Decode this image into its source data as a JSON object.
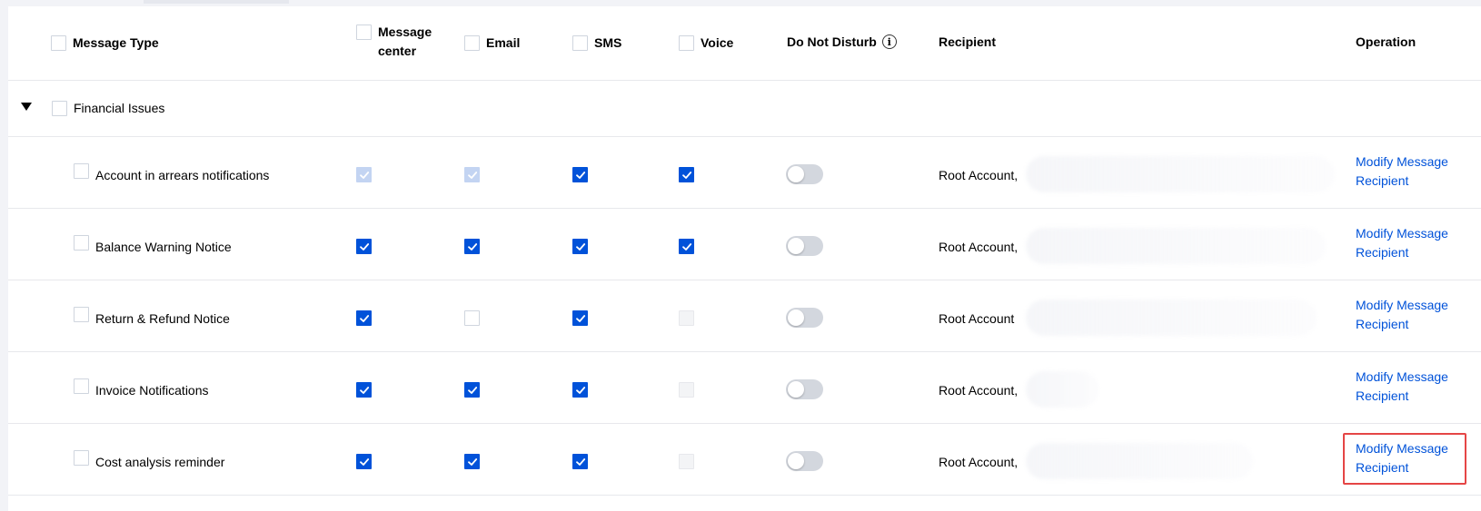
{
  "header": {
    "message_type": "Message Type",
    "message_center_line1": "Message",
    "message_center_line2": "center",
    "email": "Email",
    "sms": "SMS",
    "voice": "Voice",
    "do_not_disturb": "Do Not Disturb",
    "info_glyph": "i",
    "recipient": "Recipient",
    "operation": "Operation"
  },
  "group": {
    "label": "Financial Issues",
    "expanded": true
  },
  "rows": [
    {
      "name": "Account in arrears notifications",
      "message_center": "checked-disabled",
      "email": "checked-disabled",
      "sms": "checked",
      "voice": "checked",
      "do_not_disturb": false,
      "recipient": "Root Account,",
      "operation_line1": "Modify Message",
      "operation_line2": "Recipient"
    },
    {
      "name": "Balance Warning Notice",
      "message_center": "checked",
      "email": "checked",
      "sms": "checked",
      "voice": "checked",
      "do_not_disturb": false,
      "recipient": "Root Account,",
      "operation_line1": "Modify Message",
      "operation_line2": "Recipient"
    },
    {
      "name": "Return & Refund Notice",
      "message_center": "checked",
      "email": "unchecked",
      "sms": "checked",
      "voice": "disabled",
      "do_not_disturb": false,
      "recipient": "Root Account",
      "operation_line1": "Modify Message",
      "operation_line2": "Recipient"
    },
    {
      "name": "Invoice Notifications",
      "message_center": "checked",
      "email": "checked",
      "sms": "checked",
      "voice": "disabled",
      "do_not_disturb": false,
      "recipient": "Root Account,",
      "operation_line1": "Modify Message",
      "operation_line2": "Recipient"
    },
    {
      "name": "Cost analysis reminder",
      "message_center": "checked",
      "email": "checked",
      "sms": "checked",
      "voice": "disabled",
      "do_not_disturb": false,
      "recipient": "Root Account,",
      "operation_line1": "Modify Message",
      "operation_line2": "Recipient",
      "highlighted": true
    }
  ],
  "colors": {
    "accent": "#0052d9",
    "highlight_border": "#e54545",
    "toggle_off": "#d3d7de"
  }
}
